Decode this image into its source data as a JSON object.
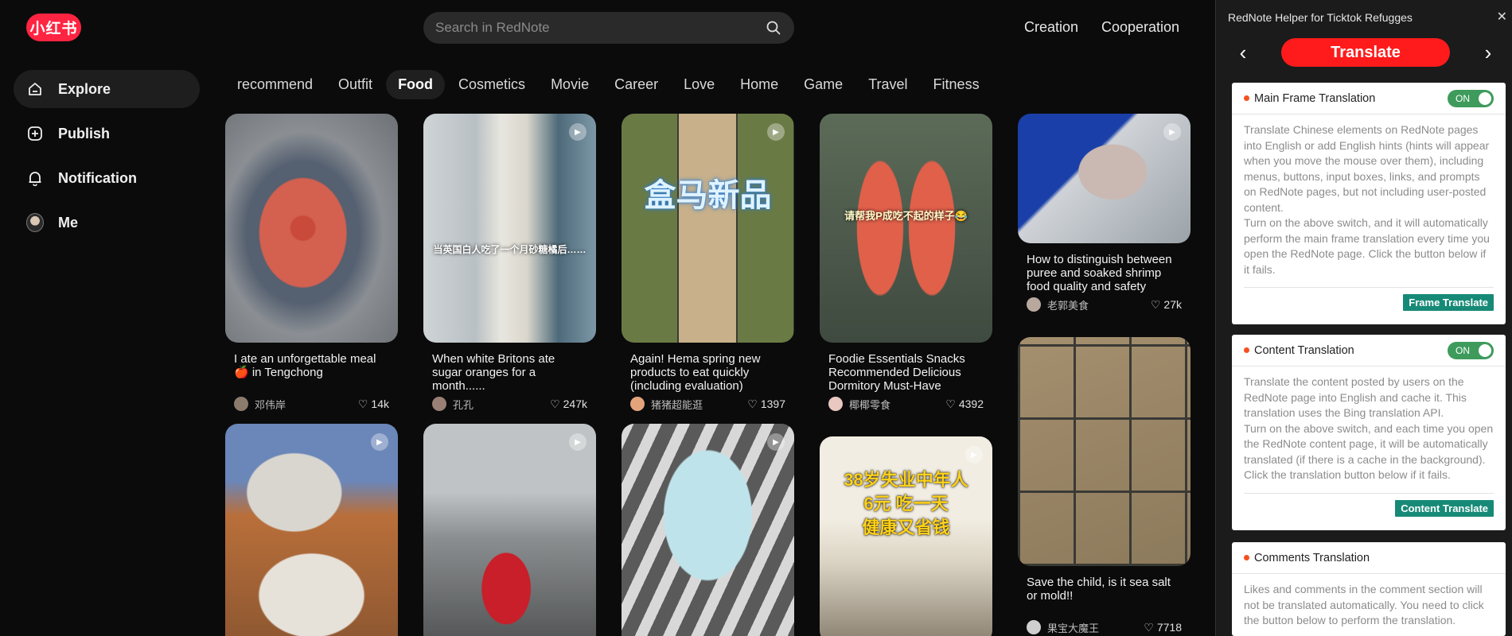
{
  "app": {
    "logo_text": "小红书",
    "search_placeholder": "Search in RedNote",
    "top_links": {
      "creation": "Creation",
      "cooperation": "Cooperation"
    },
    "sidebar": [
      {
        "label": "Explore",
        "icon": "home-icon",
        "active": true
      },
      {
        "label": "Publish",
        "icon": "plus-square-icon",
        "active": false
      },
      {
        "label": "Notification",
        "icon": "bell-icon",
        "active": false
      },
      {
        "label": "Me",
        "icon": "avatar",
        "active": false
      }
    ],
    "channels": [
      "recommend",
      "Outfit",
      "Food",
      "Cosmetics",
      "Movie",
      "Career",
      "Love",
      "Home",
      "Game",
      "Travel",
      "Fitness"
    ],
    "active_channel": "Food",
    "feed": [
      {
        "title": "I ate an unforgettable meal 🍎 in Tengchong",
        "author": "邓伟岸",
        "likes": "14k"
      },
      {
        "title": "When white Britons ate sugar oranges for a month......",
        "author": "孔孔",
        "likes": "247k",
        "overlay": "当英国白人吃了一个月砂糖橘后……"
      },
      {
        "title": "Again! Hema spring new products to eat quickly (including evaluation)",
        "author": "猪猪超能逛",
        "likes": "1397",
        "overlay": "盒马新品"
      },
      {
        "title": "Foodie Essentials Snacks Recommended Delicious Dormitory Must-Have Snacks Aff...",
        "author": "椰椰零食",
        "likes": "4392",
        "overlay": "请帮我P成吃不起的样子😂"
      },
      {
        "title": "How to distinguish between puree and soaked shrimp food quality and safety Gour...",
        "author": "老郭美食",
        "likes": "27k"
      },
      {
        "title": "Save the child, is it sea salt or mold!!",
        "author": "果宝大魔王",
        "likes": "7718"
      },
      {
        "overlay": "38岁失业中年人\n6元 吃一天\n健康又省钱"
      }
    ]
  },
  "panel": {
    "title": "RedNote Helper for Ticktok Refugges",
    "close": "✕",
    "nav_label": "Translate",
    "sections": [
      {
        "title": "Main Frame Translation",
        "toggle": "ON",
        "body": "Translate Chinese elements on RedNote pages into English or add English hints (hints will appear when you move the mouse over them), including menus, buttons, input boxes, links, and prompts on RedNote pages, but not including user-posted content.\nTurn on the above switch, and it will automatically perform the main frame translation every time you open the RedNote page. Click the button below if it fails.",
        "button": "Frame Translate"
      },
      {
        "title": "Content Translation",
        "toggle": "ON",
        "body": "Translate the content posted by users on the RedNote page into English and cache it. This translation uses the Bing translation API.\nTurn on the above switch, and each time you open the RedNote content page, it will be automatically translated (if there is a cache in the background). Click the translation button below if it fails.",
        "button": "Content Translate"
      },
      {
        "title": "Comments Translation",
        "body": "Likes and comments in the comment section will not be translated automatically. You need to click the button below to perform the translation."
      }
    ]
  }
}
